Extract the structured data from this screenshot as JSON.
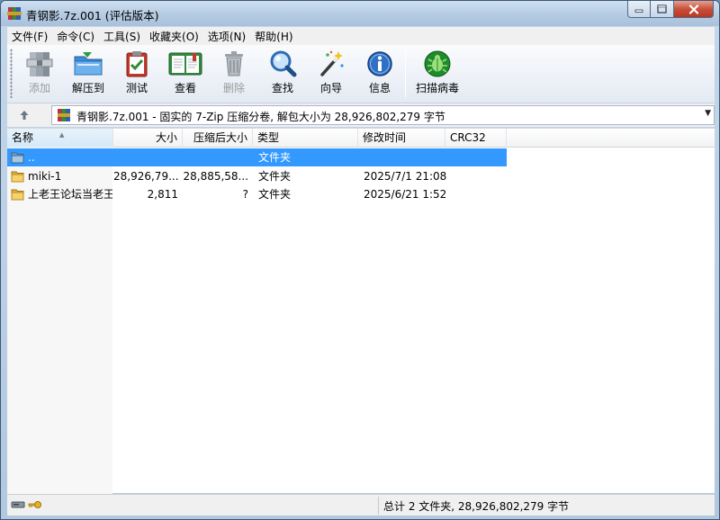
{
  "window": {
    "title": "青钢影.7z.001 (评估版本)",
    "accent": "#3399ff"
  },
  "menu": [
    "文件(F)",
    "命令(C)",
    "工具(S)",
    "收藏夹(O)",
    "选项(N)",
    "帮助(H)"
  ],
  "toolbar": {
    "add": "添加",
    "extract": "解压到",
    "test": "测试",
    "view": "查看",
    "delete": "删除",
    "find": "查找",
    "wizard": "向导",
    "info": "信息",
    "virus_scan": "扫描病毒"
  },
  "address": {
    "path": "青钢影.7z.001 - 固实的 7-Zip 压缩分卷, 解包大小为 28,926,802,279 字节"
  },
  "columns": {
    "name": "名称",
    "size": "大小",
    "packed": "压缩后大小",
    "type": "类型",
    "modified": "修改时间",
    "crc": "CRC32"
  },
  "rows": [
    {
      "name": "..",
      "size": "",
      "packed": "",
      "type": "文件夹",
      "modified": "",
      "crc": ""
    },
    {
      "name": "miki-1",
      "size": "28,926,79...",
      "packed": "28,885,58...",
      "type": "文件夹",
      "modified": "2025/7/1 21:08",
      "crc": ""
    },
    {
      "name": "上老王论坛当老王",
      "size": "2,811",
      "packed": "?",
      "type": "文件夹",
      "modified": "2025/6/21 1:52",
      "crc": ""
    }
  ],
  "status": {
    "summary": "总计 2 文件夹, 28,926,802,279 字节"
  }
}
